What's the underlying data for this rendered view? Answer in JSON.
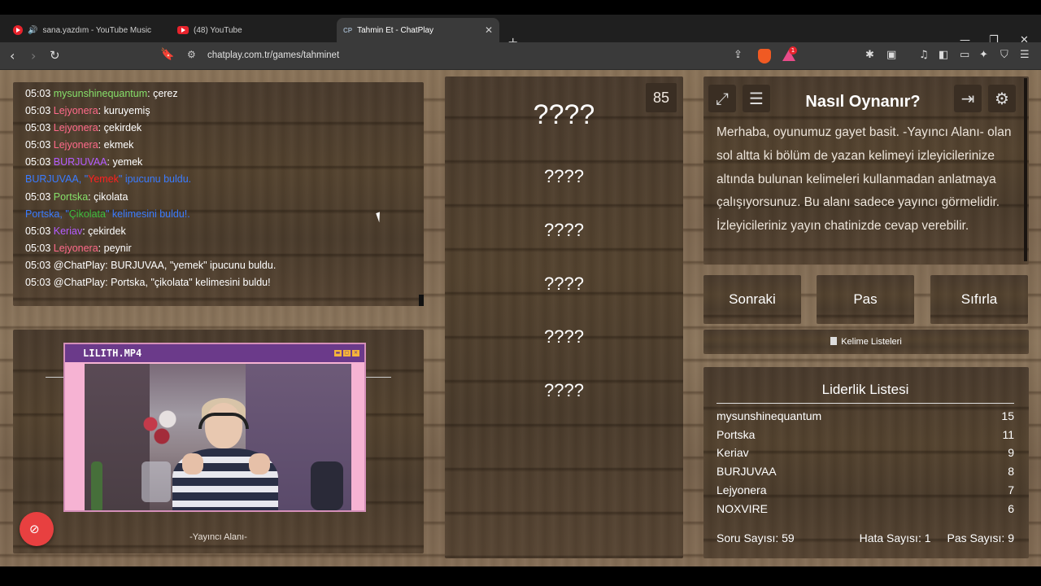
{
  "browser": {
    "tabs": [
      {
        "title": "sana.yazdım - YouTube Music",
        "active": false
      },
      {
        "title": "(48) YouTube",
        "active": false
      },
      {
        "title": "Tahmin Et - ChatPlay",
        "active": true
      }
    ],
    "favicon_cp": "CP",
    "url": "chatplay.com.tr/games/tahminet",
    "extension_badge": "1",
    "brand_color": "#f05a23"
  },
  "chat": {
    "lines": [
      {
        "time": "05:03",
        "user": "mysunshinequantum",
        "text": ": çerez"
      },
      {
        "time": "05:03",
        "user": "Lejyonera",
        "text": ": kuruyemiş"
      },
      {
        "time": "05:03",
        "user": "Lejyonera",
        "text": ": çekirdek"
      },
      {
        "time": "05:03",
        "user": "Lejyonera",
        "text": ": ekmek"
      },
      {
        "time": "05:03",
        "user": "BURJUVAA",
        "text": ": yemek"
      },
      {
        "user": "BURJUVAA",
        "mid": ", \"",
        "word": "Yemek",
        "end": "\" ipucunu buldu."
      },
      {
        "time": "05:03",
        "user": "Portska",
        "text": ": çikolata"
      },
      {
        "user": "Portska",
        "mid": ", \"",
        "word": "Çikolata",
        "end": "\" kelimesini buldu!."
      },
      {
        "time": "05:03",
        "user": "Keriav",
        "text": ": çekirdek"
      },
      {
        "time": "05:03",
        "user": "Lejyonera",
        "text": ": peynir"
      },
      {
        "time": "05:03",
        "text": "@ChatPlay: BURJUVAA, \"yemek\" ipucunu buldu."
      },
      {
        "time": "05:03",
        "text": "@ChatPlay: Portska, \"çikolata\" kelimesini buldu!"
      }
    ]
  },
  "stream": {
    "video_title": "LILITH.MP4",
    "label": "-Yayıncı Alanı-"
  },
  "game": {
    "timer": "85",
    "main_word": "????",
    "hints": [
      "????",
      "????",
      "????",
      "????",
      "????"
    ]
  },
  "howto": {
    "title": "Nasıl Oynanır?",
    "text": "Merhaba, oyunumuz gayet basit. -Yayıncı Alanı- olan sol altta ki bölüm de yazan kelimeyi izleyicilerinize altında bulunan kelimeleri kullanmadan anlatmaya çalışıyorsunuz. Bu alanı sadece yayıncı görmelidir. İzleyicileriniz yayın chatinizde cevap verebilir."
  },
  "controls": {
    "next": "Sonraki",
    "pass": "Pas",
    "reset": "Sıfırla",
    "word_lists": "Kelime Listeleri"
  },
  "leaderboard": {
    "title": "Liderlik Listesi",
    "rows": [
      {
        "name": "mysunshinequantum",
        "score": "15"
      },
      {
        "name": "Portska",
        "score": "11"
      },
      {
        "name": "Keriav",
        "score": "9"
      },
      {
        "name": "BURJUVAA",
        "score": "8"
      },
      {
        "name": "Lejyonera",
        "score": "7"
      },
      {
        "name": "NOXVIRE",
        "score": "6"
      }
    ],
    "question_count": "Soru Sayısı: 59",
    "error_count": "Hata Sayısı: 1",
    "pass_count": "Pas Sayısı: 9"
  }
}
